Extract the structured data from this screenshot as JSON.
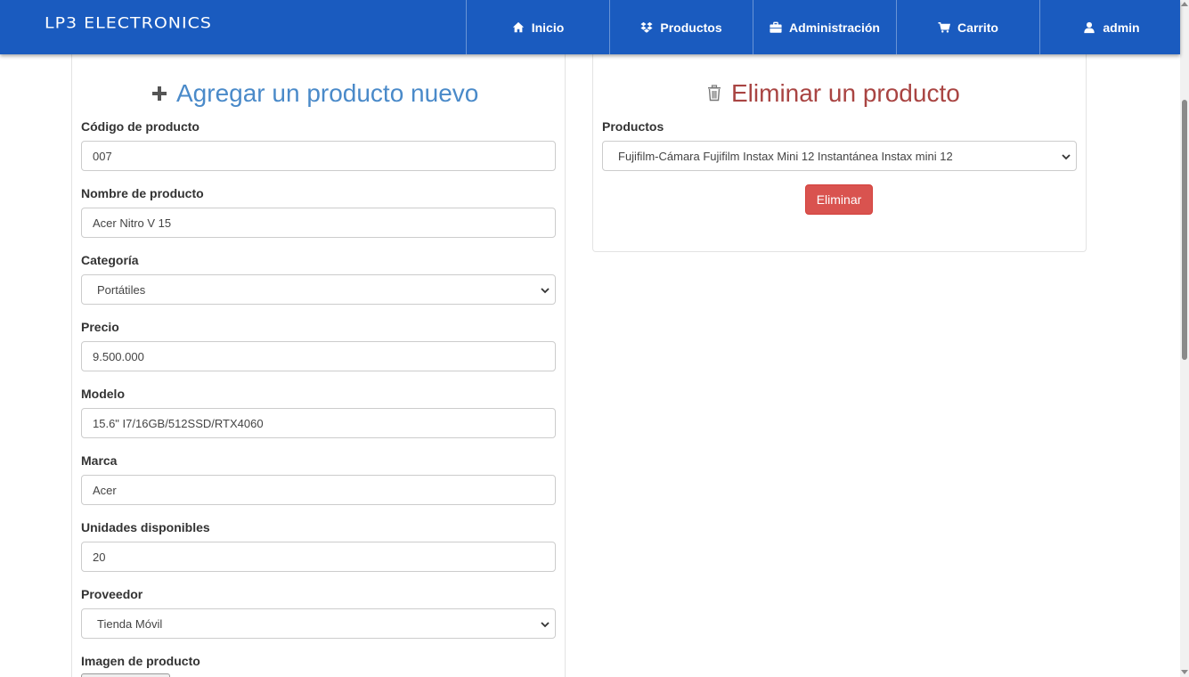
{
  "brand": "LP3 ELECTRONICS",
  "nav": [
    {
      "label": "Inicio",
      "icon": "home-icon"
    },
    {
      "label": "Productos",
      "icon": "dropbox-icon"
    },
    {
      "label": "Administración",
      "icon": "briefcase-icon"
    },
    {
      "label": "Carrito",
      "icon": "cart-icon"
    },
    {
      "label": "admin",
      "icon": "user-icon"
    }
  ],
  "add_form": {
    "title": "Agregar un producto nuevo",
    "fields": {
      "codigo": {
        "label": "Código de producto",
        "value": "007"
      },
      "nombre": {
        "label": "Nombre de producto",
        "value": "Acer Nitro V 15"
      },
      "categoria": {
        "label": "Categoría",
        "value": "Portátiles"
      },
      "precio": {
        "label": "Precio",
        "value": "9.500.000"
      },
      "modelo": {
        "label": "Modelo",
        "value": "15.6\" I7/16GB/512SSD/RTX4060"
      },
      "marca": {
        "label": "Marca",
        "value": "Acer"
      },
      "unidades": {
        "label": "Unidades disponibles",
        "value": "20"
      },
      "proveedor": {
        "label": "Proveedor",
        "value": "Tienda Móvil"
      },
      "imagen": {
        "label": "Imagen de producto"
      }
    }
  },
  "delete_form": {
    "title": "Eliminar un producto",
    "productos_label": "Productos",
    "productos_value": "Fujifilm-Cámara Fujifilm Instax Mini 12 Instantánea Instax mini 12",
    "button": "Eliminar"
  },
  "colors": {
    "navbar": "#1a5bbf",
    "add_title": "#4a8ac9",
    "delete_title": "#a94442",
    "delete_button": "#d9534f"
  }
}
